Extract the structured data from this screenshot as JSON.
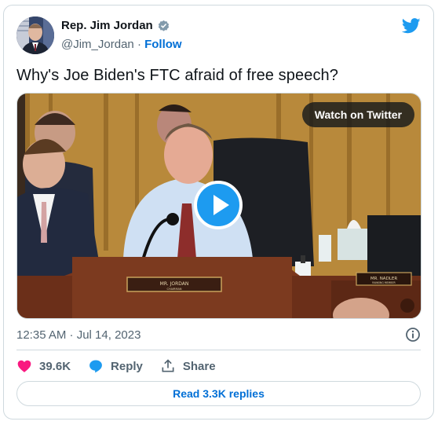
{
  "author": {
    "name": "Rep. Jim Jordan",
    "handle": "@Jim_Jordan",
    "separator": "·",
    "follow_label": "Follow"
  },
  "tweet": {
    "text": "Why's Joe Biden's FTC afraid of free speech?",
    "timestamp": "12:35 AM · Jul 14, 2023"
  },
  "media": {
    "watch_label": "Watch on Twitter",
    "nameplate_center": "MR. JORDAN",
    "nameplate_center_sub": "CHAIRMAN",
    "nameplate_right": "MR. NADLER",
    "nameplate_right_sub": "RANKING MEMBER"
  },
  "actions": {
    "likes": "39.6K",
    "reply_label": "Reply",
    "share_label": "Share"
  },
  "footer": {
    "read_replies_label": "Read 3.3K replies"
  },
  "colors": {
    "accent": "#1d9bf0",
    "link": "#006fd6",
    "like": "#f91880",
    "text_secondary": "#536471",
    "border": "#cfd9de"
  },
  "icons": [
    "verified-badge-icon",
    "twitter-bird-icon",
    "play-icon",
    "info-icon",
    "heart-icon",
    "reply-icon",
    "share-icon",
    "settings-icon"
  ]
}
